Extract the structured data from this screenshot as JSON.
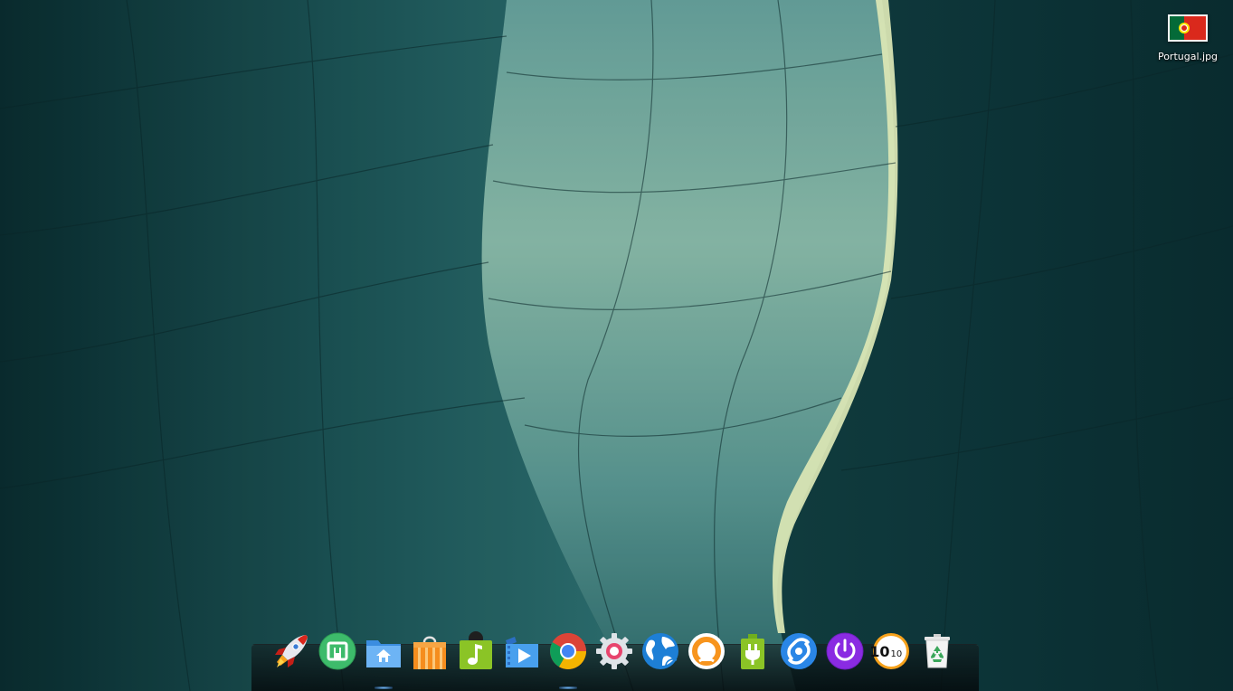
{
  "desktop": {
    "icons": [
      {
        "label": "Portugal.jpg",
        "icon": "image-file-icon"
      }
    ]
  },
  "dock": {
    "items": [
      {
        "name": "launcher",
        "icon": "rocket-icon",
        "running": false
      },
      {
        "name": "deepin-store",
        "icon": "store-icon",
        "running": false
      },
      {
        "name": "file-manager",
        "icon": "home-folder-icon",
        "running": true
      },
      {
        "name": "app-store",
        "icon": "shopping-bag-icon",
        "running": false
      },
      {
        "name": "music",
        "icon": "music-note-icon",
        "running": false
      },
      {
        "name": "movie",
        "icon": "video-player-icon",
        "running": false
      },
      {
        "name": "chrome",
        "icon": "chrome-icon",
        "running": true
      },
      {
        "name": "settings",
        "icon": "gear-icon",
        "running": false
      },
      {
        "name": "network",
        "icon": "globe-network-icon",
        "running": false
      },
      {
        "name": "feedback",
        "icon": "ring-icon",
        "running": false
      },
      {
        "name": "power",
        "icon": "battery-plug-icon",
        "running": false
      },
      {
        "name": "remote-assistance",
        "icon": "link-icon",
        "running": false
      },
      {
        "name": "shutdown",
        "icon": "power-icon",
        "running": false
      },
      {
        "name": "clock",
        "icon": "clock-icon",
        "running": false
      },
      {
        "name": "trash",
        "icon": "trash-icon",
        "running": false
      }
    ]
  },
  "clock": {
    "hour": "10",
    "minute": "10"
  },
  "colors": {
    "wallpaper_dark": "#0d3538",
    "wallpaper_mid": "#3f8a8a",
    "wallpaper_light": "#bfe0c9",
    "light_streak": "#f2ffc8",
    "dock_bg": "#0a1214"
  }
}
